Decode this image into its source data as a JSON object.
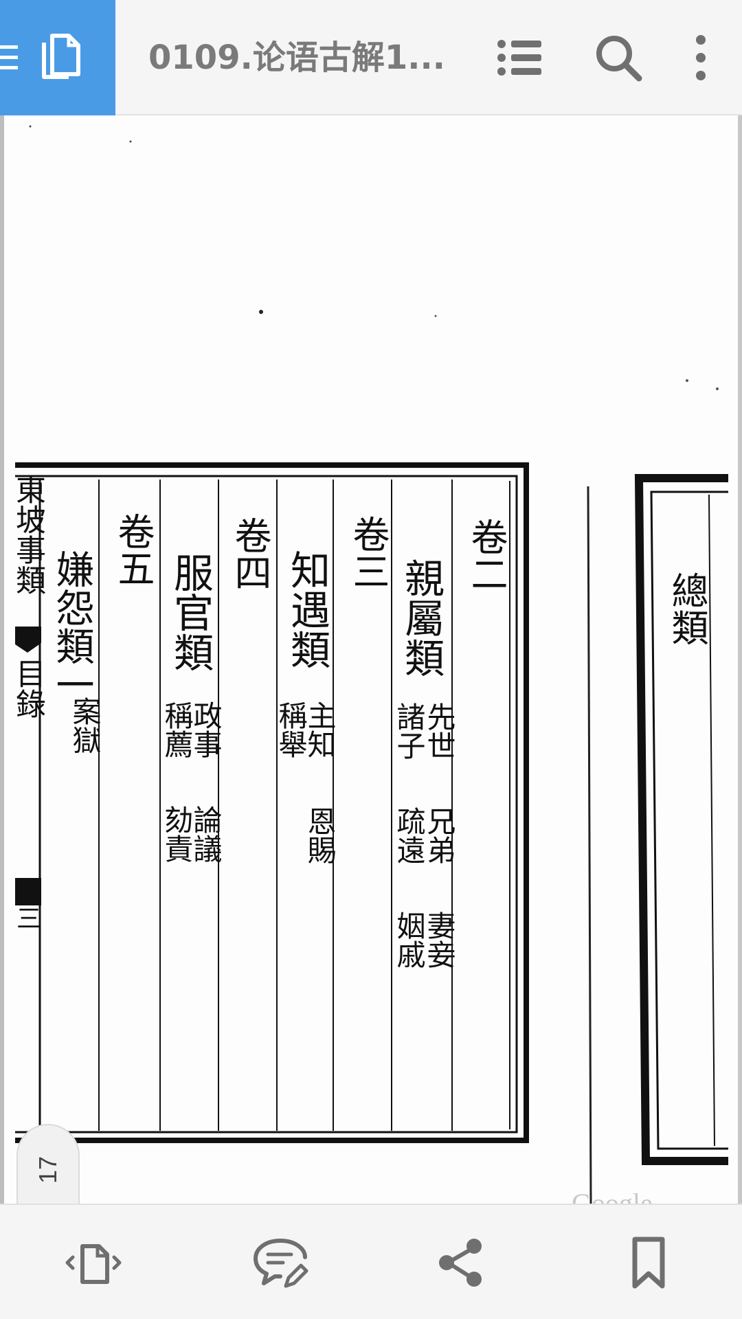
{
  "appbar": {
    "title": "0109.论语古解1...",
    "mode_icon": "document-copy-icon",
    "toc_icon": "list-icon",
    "search_icon": "search-icon",
    "more_icon": "more-vertical-icon",
    "accent_color": "#4a9be6"
  },
  "document": {
    "page_number": "17",
    "watermark": "Google",
    "margin_title": "東坡事類",
    "margin_section": "目錄",
    "margin_folio": "三",
    "columns": [
      {
        "heading": "卷二"
      },
      {
        "category": "親屬類",
        "entries": [
          "先世",
          "諸子",
          "兄弟",
          "疏遠",
          "妻妾",
          "姻戚"
        ]
      },
      {
        "heading": "卷三"
      },
      {
        "category": "知遇類",
        "entries": [
          "主知",
          "稱舉",
          "恩賜"
        ]
      },
      {
        "heading": "卷四"
      },
      {
        "category": "服官類",
        "entries": [
          "政事",
          "稱薦",
          "論議",
          "劾責"
        ]
      },
      {
        "heading": "卷五"
      },
      {
        "category": "嫌怨類一",
        "entries": [
          "案獄"
        ]
      }
    ],
    "next_page_category": "總類"
  },
  "bottombar": {
    "tools": [
      {
        "icon": "page-navigate-icon"
      },
      {
        "icon": "annotate-comment-icon"
      },
      {
        "icon": "share-icon"
      },
      {
        "icon": "bookmark-icon"
      }
    ]
  }
}
